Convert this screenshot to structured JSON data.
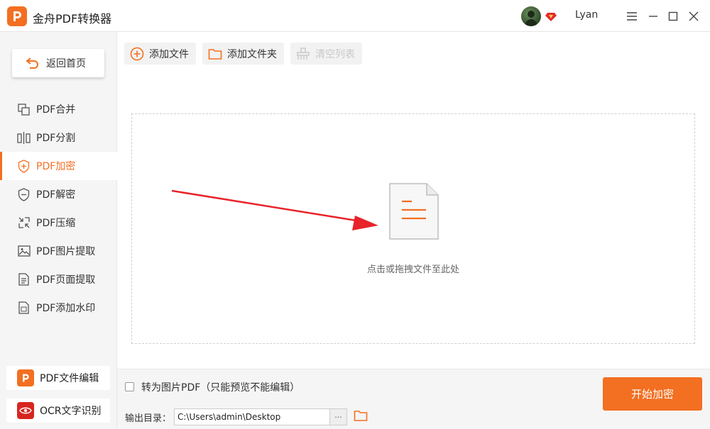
{
  "app": {
    "title": "金舟PDF转换器",
    "logo_letter": "P"
  },
  "user": {
    "name": "Lyan"
  },
  "window_controls": [
    "menu-icon",
    "minimize-icon",
    "maximize-icon",
    "close-icon"
  ],
  "sidebar": {
    "home_label": "返回首页",
    "items": [
      {
        "label": "PDF合并",
        "icon": "merge-icon",
        "active": false
      },
      {
        "label": "PDF分割",
        "icon": "split-icon",
        "active": false
      },
      {
        "label": "PDF加密",
        "icon": "shield-plus-icon",
        "active": true
      },
      {
        "label": "PDF解密",
        "icon": "shield-minus-icon",
        "active": false
      },
      {
        "label": "PDF压缩",
        "icon": "compress-icon",
        "active": false
      },
      {
        "label": "PDF图片提取",
        "icon": "image-icon",
        "active": false
      },
      {
        "label": "PDF页面提取",
        "icon": "page-icon",
        "active": false
      },
      {
        "label": "PDF添加水印",
        "icon": "watermark-icon",
        "active": false
      }
    ],
    "bottom": [
      {
        "label": "PDF文件编辑",
        "icon": "pdf-editor-icon"
      },
      {
        "label": "OCR文字识别",
        "icon": "ocr-eye-icon"
      }
    ]
  },
  "toolbar": {
    "add_file": "添加文件",
    "add_folder": "添加文件夹",
    "clear_list": "清空列表"
  },
  "dropzone": {
    "hint": "点击或拖拽文件至此处"
  },
  "options": {
    "image_pdf_label": "转为图片PDF（只能预览不能编辑）",
    "image_pdf_checked": false
  },
  "output": {
    "label": "输出目录：",
    "path": "C:\\Users\\admin\\Desktop",
    "browse_label": "···"
  },
  "start_button": "开始加密",
  "colors": {
    "accent": "#f36f21",
    "sidebar_bg": "#f5f5f5",
    "arrow": "#e8232a"
  }
}
